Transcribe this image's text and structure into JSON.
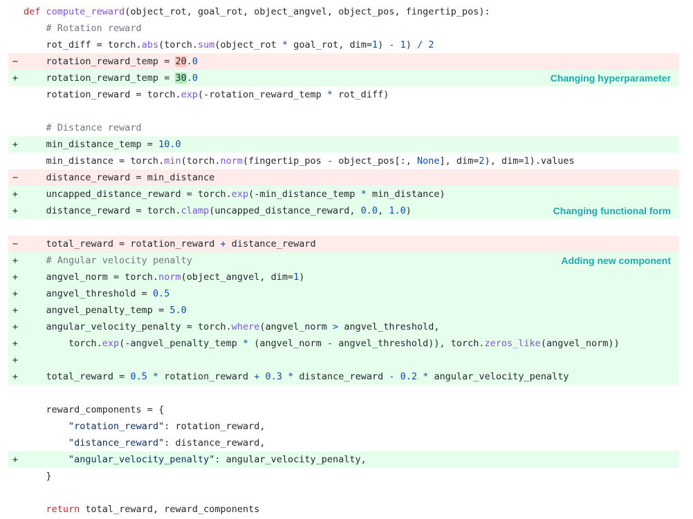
{
  "lines": [
    {
      "type": "ctx",
      "marker": "",
      "tokens": [
        [
          "kw",
          "def "
        ],
        [
          "fn",
          "compute_reward"
        ],
        [
          "",
          "(object_rot, goal_rot, object_angvel, object_pos, fingertip_pos):"
        ]
      ]
    },
    {
      "type": "ctx",
      "marker": "",
      "tokens": [
        [
          "",
          "    "
        ],
        [
          "cm",
          "# Rotation reward"
        ]
      ]
    },
    {
      "type": "ctx",
      "marker": "",
      "tokens": [
        [
          "",
          "    rot_diff = torch."
        ],
        [
          "fn",
          "abs"
        ],
        [
          "",
          "(torch."
        ],
        [
          "fn",
          "sum"
        ],
        [
          "",
          "(object_rot "
        ],
        [
          "op",
          "*"
        ],
        [
          "",
          " goal_rot, dim="
        ],
        [
          "num",
          "1"
        ],
        [
          "",
          ") "
        ],
        [
          "op",
          "-"
        ],
        [
          "",
          " "
        ],
        [
          "num",
          "1"
        ],
        [
          "",
          ") "
        ],
        [
          "op",
          "/"
        ],
        [
          "",
          " "
        ],
        [
          "num",
          "2"
        ]
      ]
    },
    {
      "type": "del",
      "marker": "−",
      "tokens": [
        [
          "",
          "    rotation_reward_temp = "
        ],
        [
          "hl-del",
          "20"
        ],
        [
          "num",
          ".0"
        ]
      ]
    },
    {
      "type": "add",
      "marker": "+",
      "note": "Changing hyperparameter",
      "tokens": [
        [
          "",
          "    rotation_reward_temp = "
        ],
        [
          "hl-add",
          "30"
        ],
        [
          "num",
          ".0"
        ]
      ]
    },
    {
      "type": "ctx",
      "marker": "",
      "tokens": [
        [
          "",
          "    rotation_reward = torch."
        ],
        [
          "fn",
          "exp"
        ],
        [
          "",
          "(-rotation_reward_temp "
        ],
        [
          "op",
          "*"
        ],
        [
          "",
          " rot_diff)"
        ]
      ]
    },
    {
      "type": "ctx",
      "marker": "",
      "tokens": []
    },
    {
      "type": "ctx",
      "marker": "",
      "tokens": [
        [
          "",
          "    "
        ],
        [
          "cm",
          "# Distance reward"
        ]
      ]
    },
    {
      "type": "add",
      "marker": "+",
      "tokens": [
        [
          "",
          "    min_distance_temp = "
        ],
        [
          "num",
          "10.0"
        ]
      ]
    },
    {
      "type": "ctx",
      "marker": "",
      "tokens": [
        [
          "",
          "    min_distance = torch."
        ],
        [
          "fn",
          "min"
        ],
        [
          "",
          "(torch."
        ],
        [
          "fn",
          "norm"
        ],
        [
          "",
          "(fingertip_pos "
        ],
        [
          "op",
          "-"
        ],
        [
          "",
          " object_pos[:, "
        ],
        [
          "cn",
          "None"
        ],
        [
          "",
          "], dim="
        ],
        [
          "num",
          "2"
        ],
        [
          "",
          "), dim="
        ],
        [
          "num",
          "1"
        ],
        [
          "",
          ").values"
        ]
      ]
    },
    {
      "type": "del",
      "marker": "−",
      "tokens": [
        [
          "",
          "    distance_reward = min_distance"
        ]
      ]
    },
    {
      "type": "add",
      "marker": "+",
      "tokens": [
        [
          "",
          "    uncapped_distance_reward = torch."
        ],
        [
          "fn",
          "exp"
        ],
        [
          "",
          "(-min_distance_temp "
        ],
        [
          "op",
          "*"
        ],
        [
          "",
          " min_distance)"
        ]
      ]
    },
    {
      "type": "add",
      "marker": "+",
      "note": "Changing functional form",
      "tokens": [
        [
          "",
          "    distance_reward = torch."
        ],
        [
          "fn",
          "clamp"
        ],
        [
          "",
          "(uncapped_distance_reward, "
        ],
        [
          "num",
          "0.0"
        ],
        [
          "",
          ", "
        ],
        [
          "num",
          "1.0"
        ],
        [
          "",
          ")"
        ]
      ]
    },
    {
      "type": "ctx",
      "marker": "",
      "tokens": []
    },
    {
      "type": "del",
      "marker": "−",
      "tokens": [
        [
          "",
          "    total_reward = rotation_reward "
        ],
        [
          "op",
          "+"
        ],
        [
          "",
          " distance_reward"
        ]
      ]
    },
    {
      "type": "add",
      "marker": "+",
      "note": "Adding new component",
      "tokens": [
        [
          "",
          "    "
        ],
        [
          "cm",
          "# Angular velocity penalty"
        ]
      ]
    },
    {
      "type": "add",
      "marker": "+",
      "tokens": [
        [
          "",
          "    angvel_norm = torch."
        ],
        [
          "fn",
          "norm"
        ],
        [
          "",
          "(object_angvel, dim="
        ],
        [
          "num",
          "1"
        ],
        [
          "",
          ")"
        ]
      ]
    },
    {
      "type": "add",
      "marker": "+",
      "tokens": [
        [
          "",
          "    angvel_threshold = "
        ],
        [
          "num",
          "0.5"
        ]
      ]
    },
    {
      "type": "add",
      "marker": "+",
      "tokens": [
        [
          "",
          "    angvel_penalty_temp = "
        ],
        [
          "num",
          "5.0"
        ]
      ]
    },
    {
      "type": "add",
      "marker": "+",
      "tokens": [
        [
          "",
          "    angular_velocity_penalty = torch."
        ],
        [
          "fn",
          "where"
        ],
        [
          "",
          "(angvel_norm "
        ],
        [
          "op",
          ">"
        ],
        [
          "",
          " angvel_threshold,"
        ]
      ]
    },
    {
      "type": "add",
      "marker": "+",
      "tokens": [
        [
          "",
          "        torch."
        ],
        [
          "fn",
          "exp"
        ],
        [
          "",
          "(-angvel_penalty_temp "
        ],
        [
          "op",
          "*"
        ],
        [
          "",
          " (angvel_norm "
        ],
        [
          "op",
          "-"
        ],
        [
          "",
          " angvel_threshold)), torch."
        ],
        [
          "fn",
          "zeros_like"
        ],
        [
          "",
          "(angvel_norm))"
        ]
      ]
    },
    {
      "type": "add",
      "marker": "+",
      "tokens": []
    },
    {
      "type": "add",
      "marker": "+",
      "tokens": [
        [
          "",
          "    total_reward = "
        ],
        [
          "num",
          "0.5"
        ],
        [
          "",
          " "
        ],
        [
          "op",
          "*"
        ],
        [
          "",
          " rotation_reward "
        ],
        [
          "op",
          "+"
        ],
        [
          "",
          " "
        ],
        [
          "num",
          "0.3"
        ],
        [
          "",
          " "
        ],
        [
          "op",
          "*"
        ],
        [
          "",
          " distance_reward "
        ],
        [
          "op",
          "-"
        ],
        [
          "",
          " "
        ],
        [
          "num",
          "0.2"
        ],
        [
          "",
          " "
        ],
        [
          "op",
          "*"
        ],
        [
          "",
          " angular_velocity_penalty"
        ]
      ]
    },
    {
      "type": "ctx",
      "marker": "",
      "tokens": []
    },
    {
      "type": "ctx",
      "marker": "",
      "tokens": [
        [
          "",
          "    reward_components = {"
        ]
      ]
    },
    {
      "type": "ctx",
      "marker": "",
      "tokens": [
        [
          "",
          "        "
        ],
        [
          "str",
          "\"rotation_reward\""
        ],
        [
          "",
          ": rotation_reward,"
        ]
      ]
    },
    {
      "type": "ctx",
      "marker": "",
      "tokens": [
        [
          "",
          "        "
        ],
        [
          "str",
          "\"distance_reward\""
        ],
        [
          "",
          ": distance_reward,"
        ]
      ]
    },
    {
      "type": "add",
      "marker": "+",
      "tokens": [
        [
          "",
          "        "
        ],
        [
          "str",
          "\"angular_velocity_penalty\""
        ],
        [
          "",
          ": angular_velocity_penalty,"
        ]
      ]
    },
    {
      "type": "ctx",
      "marker": "",
      "tokens": [
        [
          "",
          "    }"
        ]
      ]
    },
    {
      "type": "ctx",
      "marker": "",
      "tokens": []
    },
    {
      "type": "ctx",
      "marker": "",
      "tokens": [
        [
          "",
          "    "
        ],
        [
          "kw",
          "return"
        ],
        [
          "",
          " total_reward, reward_components"
        ]
      ]
    }
  ]
}
